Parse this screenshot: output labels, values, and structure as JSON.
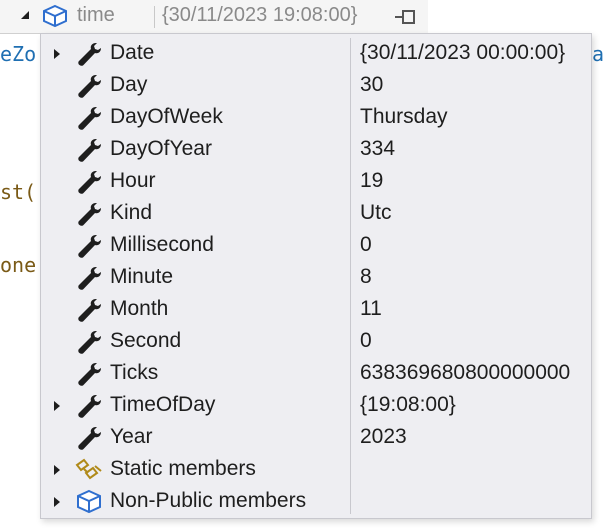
{
  "header": {
    "name": "time",
    "value": "{30/11/2023 19:08:00}"
  },
  "background_code": {
    "line1_left": "eZo",
    "line1_right": "a",
    "line2": "st(",
    "line3": "one"
  },
  "members": [
    {
      "name": "Date",
      "value": "{30/11/2023 00:00:00}",
      "expandable": true,
      "icon": "wrench-icon"
    },
    {
      "name": "Day",
      "value": "30",
      "expandable": false,
      "icon": "wrench-icon"
    },
    {
      "name": "DayOfWeek",
      "value": "Thursday",
      "expandable": false,
      "icon": "wrench-icon"
    },
    {
      "name": "DayOfYear",
      "value": "334",
      "expandable": false,
      "icon": "wrench-icon"
    },
    {
      "name": "Hour",
      "value": "19",
      "expandable": false,
      "icon": "wrench-icon"
    },
    {
      "name": "Kind",
      "value": "Utc",
      "expandable": false,
      "icon": "wrench-icon"
    },
    {
      "name": "Millisecond",
      "value": "0",
      "expandable": false,
      "icon": "wrench-icon"
    },
    {
      "name": "Minute",
      "value": "8",
      "expandable": false,
      "icon": "wrench-icon"
    },
    {
      "name": "Month",
      "value": "11",
      "expandable": false,
      "icon": "wrench-icon"
    },
    {
      "name": "Second",
      "value": "0",
      "expandable": false,
      "icon": "wrench-icon"
    },
    {
      "name": "Ticks",
      "value": "638369680800000000",
      "expandable": false,
      "icon": "wrench-icon"
    },
    {
      "name": "TimeOfDay",
      "value": "{19:08:00}",
      "expandable": true,
      "icon": "wrench-icon"
    },
    {
      "name": "Year",
      "value": "2023",
      "expandable": false,
      "icon": "wrench-icon"
    },
    {
      "name": "Static members",
      "value": "",
      "expandable": true,
      "icon": "static-members-icon"
    },
    {
      "name": "Non-Public members",
      "value": "",
      "expandable": true,
      "icon": "cube-icon"
    }
  ],
  "colors": {
    "code_blue": "#1f6fb2",
    "code_brown": "#7a5a16",
    "cube_blue": "#2f6fcf",
    "static_gold": "#c9a227"
  }
}
